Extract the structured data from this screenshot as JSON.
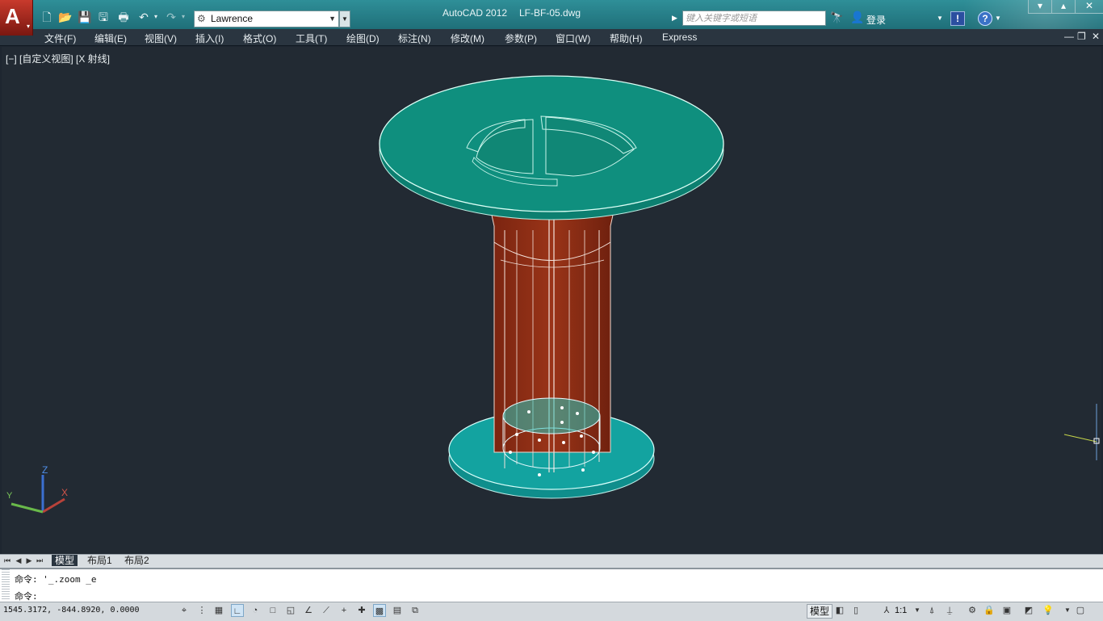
{
  "app": {
    "title": "AutoCAD 2012",
    "file": "LF-BF-05.dwg"
  },
  "quick_access": {
    "workspace_value": "Lawrence",
    "icons": [
      "new-icon",
      "open-icon",
      "save-icon",
      "save-as-icon",
      "print-icon",
      "undo-icon",
      "redo-icon"
    ]
  },
  "search": {
    "placeholder": "键入关键字或短语"
  },
  "login": {
    "label": "登录"
  },
  "help": {
    "exchange_glyph": "!",
    "help_glyph": "?"
  },
  "window_controls": {
    "minimize": "▾",
    "restore": "▴",
    "close": "✕"
  },
  "menu": {
    "items": [
      "文件(F)",
      "编辑(E)",
      "视图(V)",
      "插入(I)",
      "格式(O)",
      "工具(T)",
      "绘图(D)",
      "标注(N)",
      "修改(M)",
      "参数(P)",
      "窗口(W)",
      "帮助(H)",
      "Express"
    ],
    "mdi": {
      "minimize": "—",
      "restore": "❐",
      "close": "✕"
    }
  },
  "viewport": {
    "label": "[−] [自定义视图] [X 射线]"
  },
  "ucs": {
    "x": "X",
    "y": "Y",
    "z": "Z"
  },
  "tabs": {
    "items": [
      "模型",
      "布局1",
      "布局2"
    ],
    "active": "模型"
  },
  "command": {
    "history": "命令: '_.zoom _e",
    "prompt": "命令:"
  },
  "status": {
    "coords": "1545.3172, -844.8920, 0.0000",
    "model": "模型",
    "annotation_scale": "1:1"
  },
  "colors": {
    "tabletop": "#0e8f80",
    "base": "#109c9a",
    "column": "#8a2a10",
    "background": "#222a33"
  }
}
